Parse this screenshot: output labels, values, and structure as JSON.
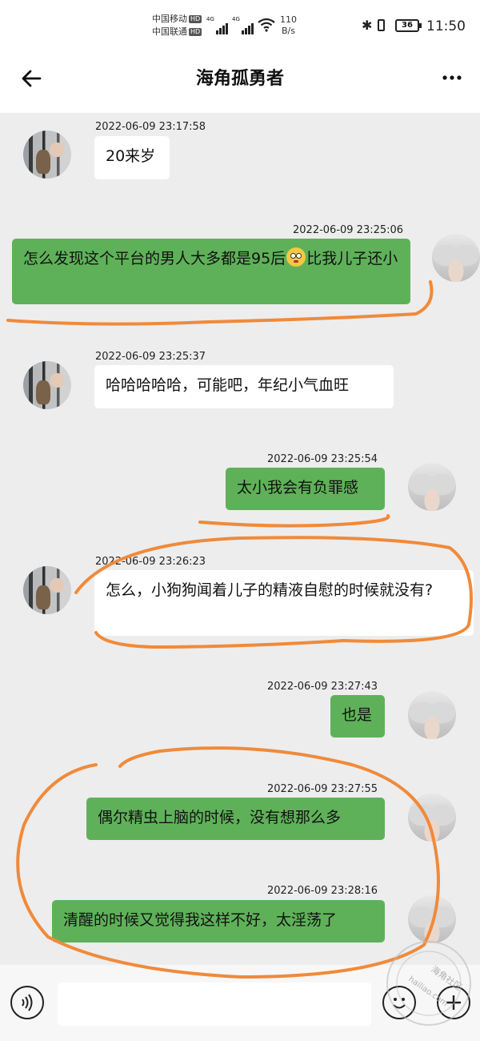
{
  "status_bar": {
    "carrier_1": "中国移动",
    "carrier_2": "中国联通",
    "hd_badge": "HD",
    "net_type_1": "4G",
    "net_type_2": "4G",
    "net_speed_value": "110",
    "net_speed_unit": "B/s",
    "battery": "36",
    "time": "11:50"
  },
  "header": {
    "title": "海角孤勇者"
  },
  "messages": [
    {
      "side": "in",
      "avatar": "cat-avatar",
      "timestamp": "2022-06-09 23:17:58",
      "text": "20来岁"
    },
    {
      "side": "out",
      "avatar": "girl-avatar",
      "timestamp": "2022-06-09 23:25:06",
      "text_before_emoji": "怎么发现这个平台的男人大多都是95后",
      "emoji": "flushed-face-emoji",
      "text_after_emoji": "比我儿子还小"
    },
    {
      "side": "in",
      "avatar": "cat-avatar",
      "timestamp": "2022-06-09 23:25:37",
      "text": "哈哈哈哈哈，可能吧，年纪小气血旺"
    },
    {
      "side": "out",
      "avatar": "girl-avatar",
      "timestamp": "2022-06-09 23:25:54",
      "text": "太小我会有负罪感"
    },
    {
      "side": "in",
      "avatar": "cat-avatar",
      "timestamp": "2022-06-09 23:26:23",
      "text": "怎么，小狗狗闻着儿子的精液自慰的时候就没有?"
    },
    {
      "side": "out",
      "avatar": "girl-avatar",
      "timestamp": "2022-06-09 23:27:43",
      "text": "也是"
    },
    {
      "side": "out",
      "avatar": "girl-avatar",
      "timestamp": "2022-06-09 23:27:55",
      "text": "偶尔精虫上脑的时候，没有想那么多"
    },
    {
      "side": "out",
      "avatar": "girl-avatar",
      "timestamp": "2022-06-09 23:28:16",
      "text": "清醒的时候又觉得我这样不好，太淫荡了"
    }
  ],
  "input_bar": {
    "placeholder": ""
  },
  "watermark": {
    "line1": "海角社区",
    "line2": "hailiao.com"
  },
  "colors": {
    "outgoing_bubble": "#5fb159",
    "incoming_bubble": "#ffffff",
    "chat_background": "#ededed",
    "annotation_stroke": "#f08a3a"
  }
}
